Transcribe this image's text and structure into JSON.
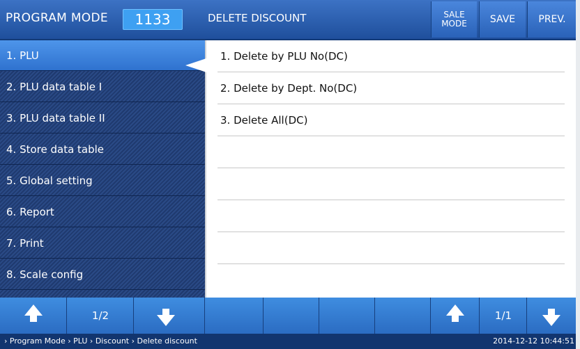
{
  "header": {
    "title": "PROGRAM MODE",
    "code": "1133",
    "subtitle": "DELETE DISCOUNT",
    "buttons": {
      "sale_mode_line1": "SALE",
      "sale_mode_line2": "MODE",
      "save": "SAVE",
      "prev": "PREV."
    }
  },
  "sidebar": {
    "items": [
      {
        "label": "1. PLU"
      },
      {
        "label": "2. PLU data table I"
      },
      {
        "label": "3. PLU data table II"
      },
      {
        "label": "4. Store data table"
      },
      {
        "label": "5. Global setting"
      },
      {
        "label": "6. Report"
      },
      {
        "label": "7. Print"
      },
      {
        "label": "8. Scale config"
      }
    ],
    "active_index": 0
  },
  "main": {
    "items": [
      {
        "label": "1. Delete by PLU No(DC)"
      },
      {
        "label": "2. Delete by Dept. No(DC)"
      },
      {
        "label": "3. Delete All(DC)"
      },
      {
        "label": ""
      },
      {
        "label": ""
      },
      {
        "label": ""
      },
      {
        "label": ""
      }
    ]
  },
  "pager": {
    "left_page": "1/2",
    "right_page": "1/1"
  },
  "status": {
    "breadcrumb": "› Program Mode › PLU › Discount › Delete discount",
    "datetime": "2014-12-12 10:44:51"
  },
  "colors": {
    "header": "#2a5fb0",
    "active_item": "#3d84de",
    "sidebar": "#24427a",
    "status_bar": "#12356f"
  },
  "icons": [
    "arrow-up-icon",
    "arrow-down-icon"
  ]
}
